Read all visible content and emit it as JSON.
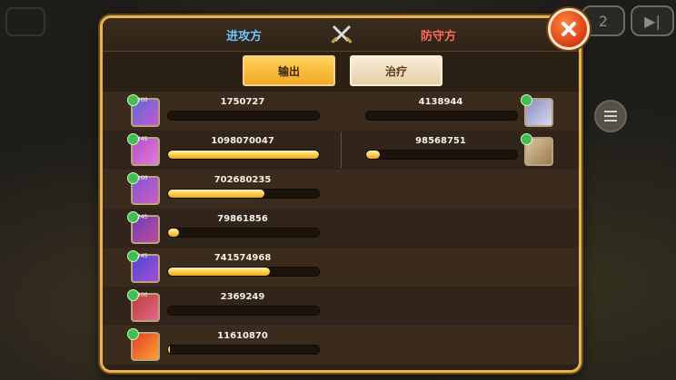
{
  "header": {
    "attack_label": "进攻方",
    "defense_label": "防守方"
  },
  "tabs": [
    {
      "label": "输出",
      "active": true
    },
    {
      "label": "治疗",
      "active": false
    }
  ],
  "attackers": [
    {
      "level": "200",
      "damage": "1750727",
      "ratio": 0.0
    },
    {
      "level": "245",
      "damage": "1098070047",
      "ratio": 1.0
    },
    {
      "level": "200",
      "damage": "702680235",
      "ratio": 0.64
    },
    {
      "level": "245",
      "damage": "79861856",
      "ratio": 0.07
    },
    {
      "level": "245",
      "damage": "741574968",
      "ratio": 0.675
    },
    {
      "level": "200",
      "damage": "2369249",
      "ratio": 0.0
    },
    {
      "level": "",
      "damage": "11610870",
      "ratio": 0.01
    }
  ],
  "defenders": [
    {
      "level": "",
      "damage": "4138944",
      "ratio": 0.0
    },
    {
      "level": "",
      "damage": "98568751",
      "ratio": 0.09
    }
  ],
  "colors": {
    "attack": "#6ac4ff",
    "defense": "#ff6a5c",
    "bar_fill": "#ffd050",
    "panel_border": "#e7b455"
  },
  "icons": {
    "close": "close-icon",
    "versus": "crossed-swords-icon",
    "menu": "menu-icon",
    "speed": "speed-icon",
    "skip": "skip-icon"
  }
}
